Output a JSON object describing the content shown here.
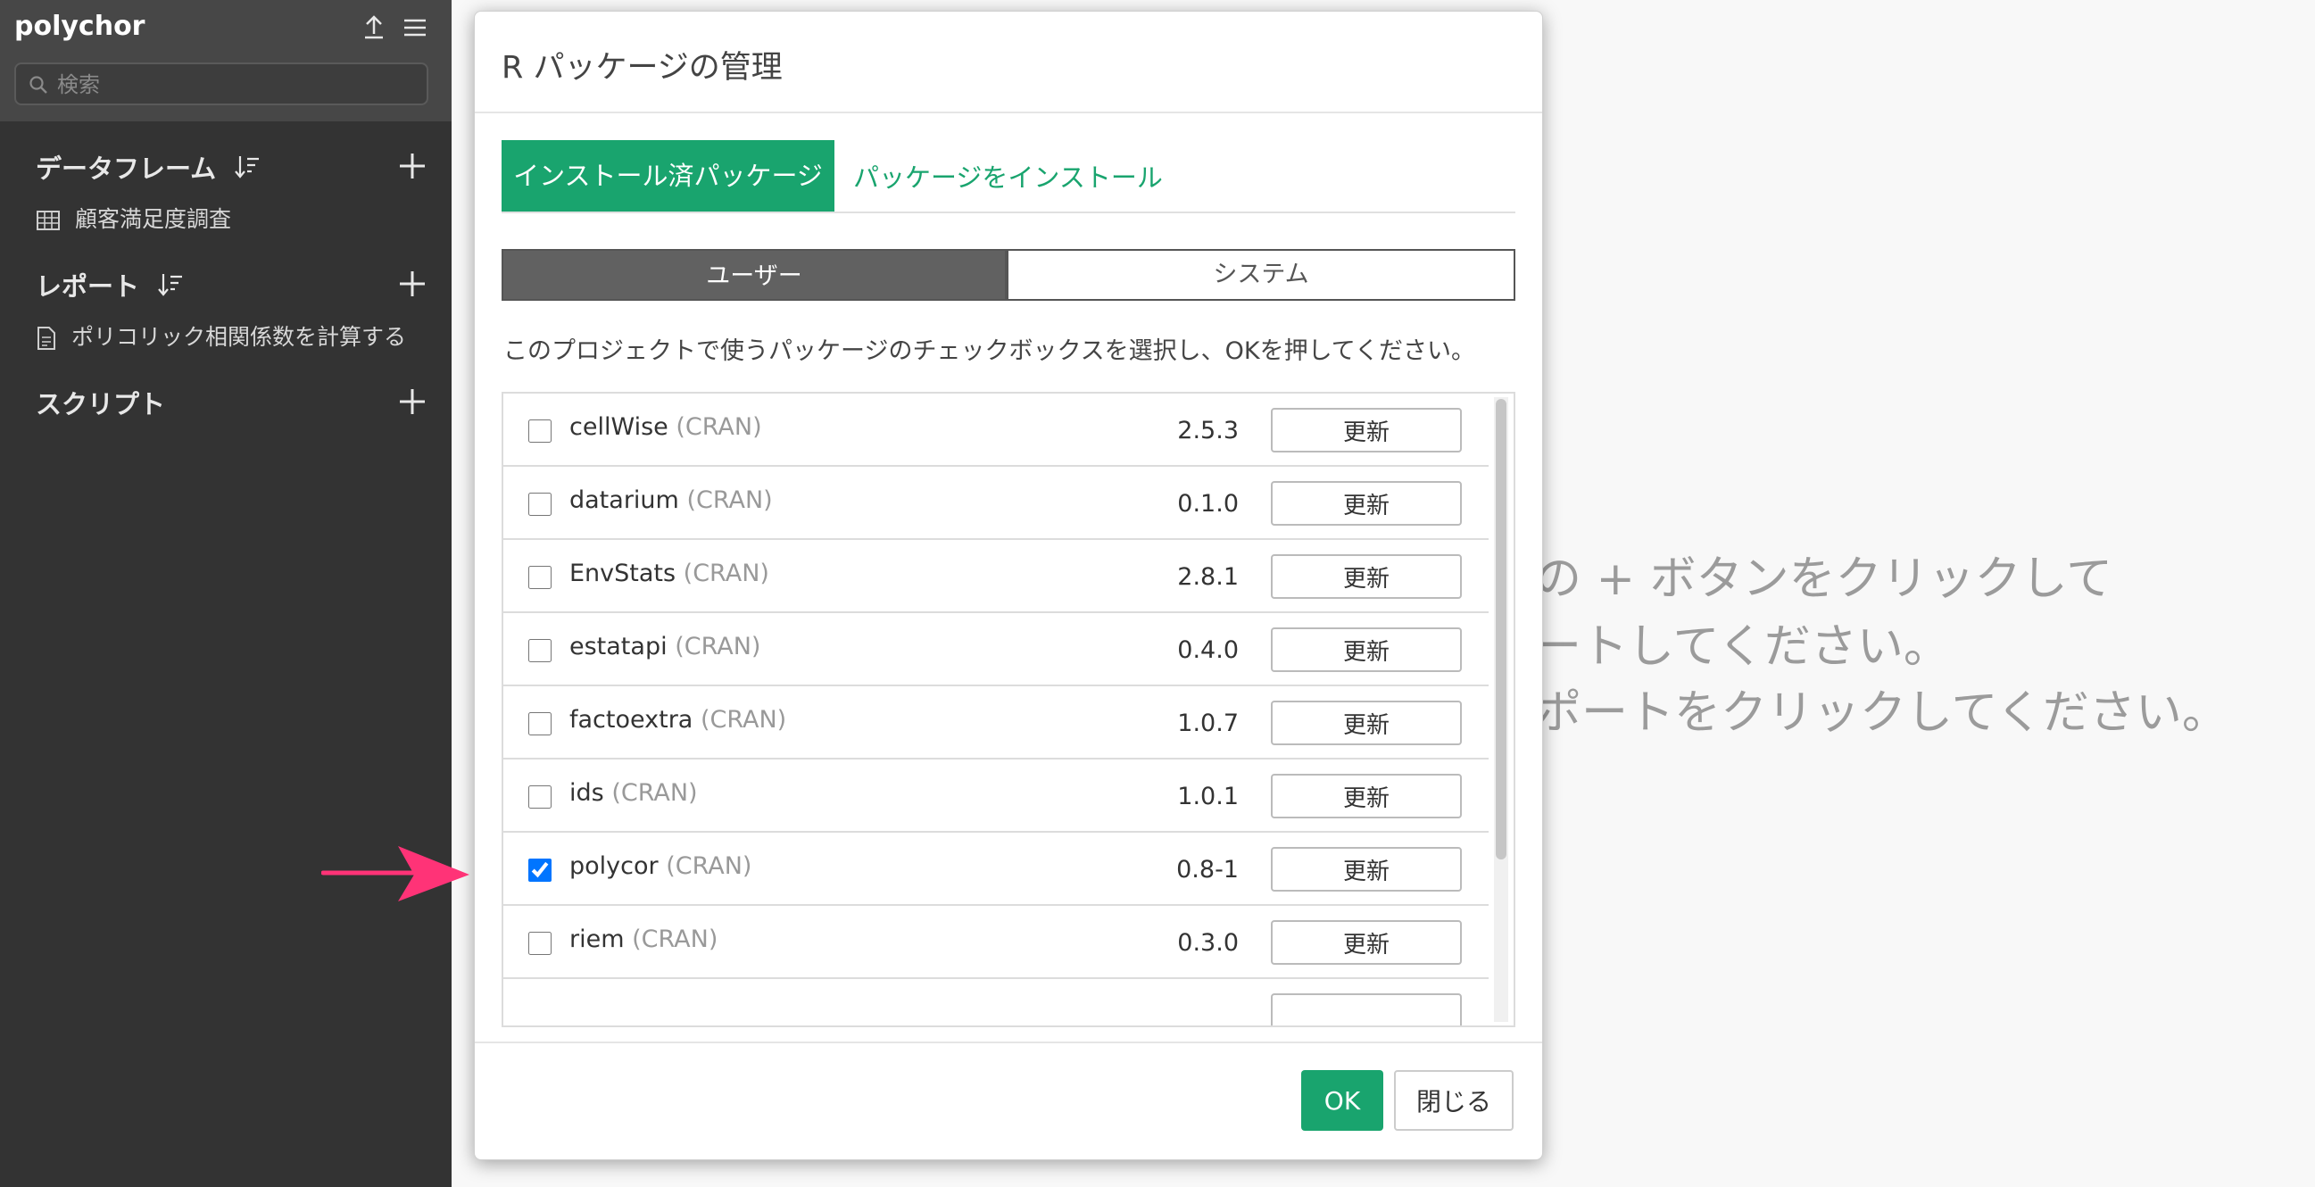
{
  "sidebar": {
    "project_title": "polychor",
    "search_placeholder": "検索",
    "sections": [
      {
        "title": "データフレーム",
        "items": [
          "顧客満足度調査"
        ]
      },
      {
        "title": "レポート",
        "items": [
          "ポリコリック相関係数を計算する"
        ]
      },
      {
        "title": "スクリプト",
        "items": []
      }
    ]
  },
  "background_hint": {
    "lines": [
      "の + ボタンをクリックして",
      "ートしてください。",
      "ポートをクリックしてください。"
    ]
  },
  "modal": {
    "title": "R パッケージの管理",
    "tabs": [
      {
        "label": "インストール済パッケージ",
        "active": true
      },
      {
        "label": "パッケージをインストール",
        "active": false
      }
    ],
    "segments": [
      {
        "label": "ユーザー",
        "active": true
      },
      {
        "label": "システム",
        "active": false
      }
    ],
    "instruction": "このプロジェクトで使うパッケージのチェックボックスを選択し、OKを押してください。",
    "update_label": "更新",
    "packages": [
      {
        "name": "cellWise",
        "repo": "(CRAN)",
        "version": "2.5.3",
        "checked": false
      },
      {
        "name": "datarium",
        "repo": "(CRAN)",
        "version": "0.1.0",
        "checked": false
      },
      {
        "name": "EnvStats",
        "repo": "(CRAN)",
        "version": "2.8.1",
        "checked": false
      },
      {
        "name": "estatapi",
        "repo": "(CRAN)",
        "version": "0.4.0",
        "checked": false
      },
      {
        "name": "factoextra",
        "repo": "(CRAN)",
        "version": "1.0.7",
        "checked": false
      },
      {
        "name": "ids",
        "repo": "(CRAN)",
        "version": "1.0.1",
        "checked": false
      },
      {
        "name": "polycor",
        "repo": "(CRAN)",
        "version": "0.8-1",
        "checked": true
      },
      {
        "name": "riem",
        "repo": "(CRAN)",
        "version": "0.3.0",
        "checked": false
      }
    ],
    "ok_label": "OK",
    "close_label": "閉じる"
  },
  "colors": {
    "accent": "#19a46e",
    "sidebar_bg": "#333333",
    "sidebar_header_bg": "#474747",
    "segment_active": "#616161",
    "arrow": "#ff3377"
  }
}
